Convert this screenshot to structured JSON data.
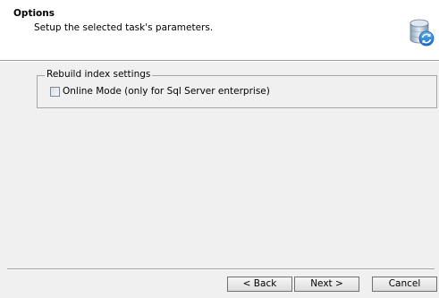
{
  "header": {
    "title": "Options",
    "subtitle": "Setup the selected task's parameters.",
    "icon": "database-sync-icon"
  },
  "group": {
    "legend": "Rebuild index settings",
    "checkbox_label": "Online Mode (only for Sql Server enterprise)",
    "checkbox_checked": false
  },
  "footer": {
    "back_label": "< Back",
    "next_label": "Next >",
    "cancel_label": "Cancel"
  }
}
